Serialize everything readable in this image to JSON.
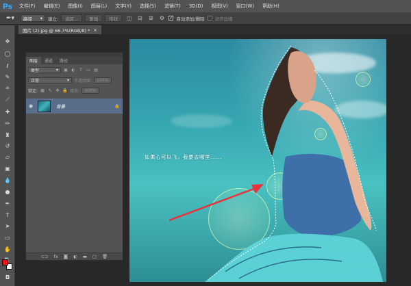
{
  "app": {
    "logo": "Ps"
  },
  "menu": [
    "文件(F)",
    "编辑(E)",
    "图像(I)",
    "图层(L)",
    "文字(Y)",
    "选择(S)",
    "滤镜(T)",
    "3D(D)",
    "视图(V)",
    "窗口(W)",
    "帮助(H)"
  ],
  "options": {
    "mode_value": "路径",
    "build_label": "建立:",
    "selection_btn": "选区...",
    "mask_btn": "蒙版",
    "shape_btn": "形状",
    "auto_add_delete": "自动添加/删除",
    "align_edges": "对齐边缘"
  },
  "document": {
    "tab_title": "图片 (2).jpg @ 66.7%(RGB/8) *",
    "close": "×"
  },
  "layers_panel": {
    "tabs": [
      "图层",
      "通道",
      "路径"
    ],
    "filter_kind": "类型",
    "blend_mode": "正常",
    "opacity_label": "不透明度:",
    "opacity_value": "100%",
    "lock_label": "锁定:",
    "fill_label": "填充:",
    "fill_value": "100%",
    "layers": [
      {
        "name": "背景",
        "visible": true,
        "locked": true
      }
    ]
  },
  "canvas": {
    "caption": "如果心可以飞，我要去哪里......"
  },
  "colors": {
    "foreground": "#e8101a",
    "background": "#ffffff",
    "arrow": "#e8323c",
    "ps_blue": "#30a8ff"
  }
}
